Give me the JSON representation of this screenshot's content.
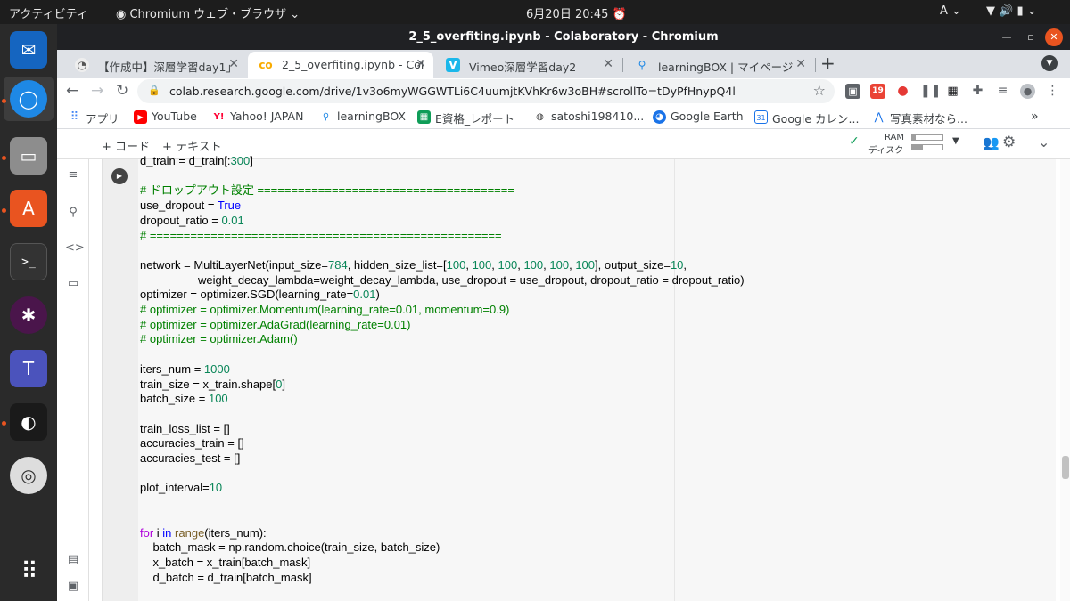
{
  "topbar": {
    "activities": "アクティビティ",
    "app_name": "Chromium ウェブ・ブラウザ",
    "datetime": "6月20日 20:45",
    "input_method": "A"
  },
  "window": {
    "title": "2_5_overfiting.ipynb - Colaboratory - Chromium"
  },
  "tabs": [
    {
      "label": "【作成中】深層学習day1」",
      "icon": "doc-icon"
    },
    {
      "label": "2_5_overfiting.ipynb - Col",
      "icon": "colab-icon",
      "active": true
    },
    {
      "label": "Vimeo深層学習day2",
      "icon": "vimeo-icon"
    },
    {
      "label": "learningBOX | マイページ",
      "icon": "learningbox-icon"
    }
  ],
  "address": {
    "url": "colab.research.google.com/drive/1v3o6myWGGWTLi6C4uumjtKVhKr6w3oBH#scrollTo=tDyPfHnypQ4l"
  },
  "extensions": {
    "gmail_badge": "19"
  },
  "bookmarks": [
    {
      "label": "アプリ",
      "icon": "apps-icon",
      "color": "#4285f4"
    },
    {
      "label": "YouTube",
      "icon": "youtube-icon",
      "color": "#ff0000"
    },
    {
      "label": "Yahoo! JAPAN",
      "icon": "yahoo-icon",
      "color": "#ff0033"
    },
    {
      "label": "learningBOX",
      "icon": "learningbox-icon",
      "color": "#1e88e5"
    },
    {
      "label": "E資格_レポート",
      "icon": "sheets-icon",
      "color": "#0f9d58"
    },
    {
      "label": "satoshi198410...",
      "icon": "github-icon",
      "color": "#333333"
    },
    {
      "label": "Google Earth",
      "icon": "earth-icon",
      "color": "#1a73e8"
    },
    {
      "label": "Google カレン...",
      "icon": "calendar-icon",
      "color": "#1a73e8"
    },
    {
      "label": "写真素材なら...",
      "icon": "photo-icon",
      "color": "#1a73e8"
    }
  ],
  "colab": {
    "add_code": "+ コード",
    "add_text": "+ テキスト",
    "ram_label": "RAM",
    "disk_label": "ディスク"
  },
  "code_lines": [
    "d_train = d_train[:300]",
    "",
    "# ドロップアウト設定 ======================================",
    "use_dropout = True",
    "dropout_ratio = 0.01",
    "# ====================================================",
    "",
    "network = MultiLayerNet(input_size=784, hidden_size_list=[100, 100, 100, 100, 100, 100], output_size=10,",
    "                  weight_decay_lambda=weight_decay_lambda, use_dropout = use_dropout, dropout_ratio = dropout_ratio)",
    "optimizer = optimizer.SGD(learning_rate=0.01)",
    "# optimizer = optimizer.Momentum(learning_rate=0.01, momentum=0.9)",
    "# optimizer = optimizer.AdaGrad(learning_rate=0.01)",
    "# optimizer = optimizer.Adam()",
    "",
    "iters_num = 1000",
    "train_size = x_train.shape[0]",
    "batch_size = 100",
    "",
    "train_loss_list = []",
    "accuracies_train = []",
    "accuracies_test = []",
    "",
    "plot_interval=10",
    "",
    "",
    "for i in range(iters_num):",
    "    batch_mask = np.random.choice(train_size, batch_size)",
    "    x_batch = x_train[batch_mask]",
    "    d_batch = d_train[batch_mask]"
  ]
}
